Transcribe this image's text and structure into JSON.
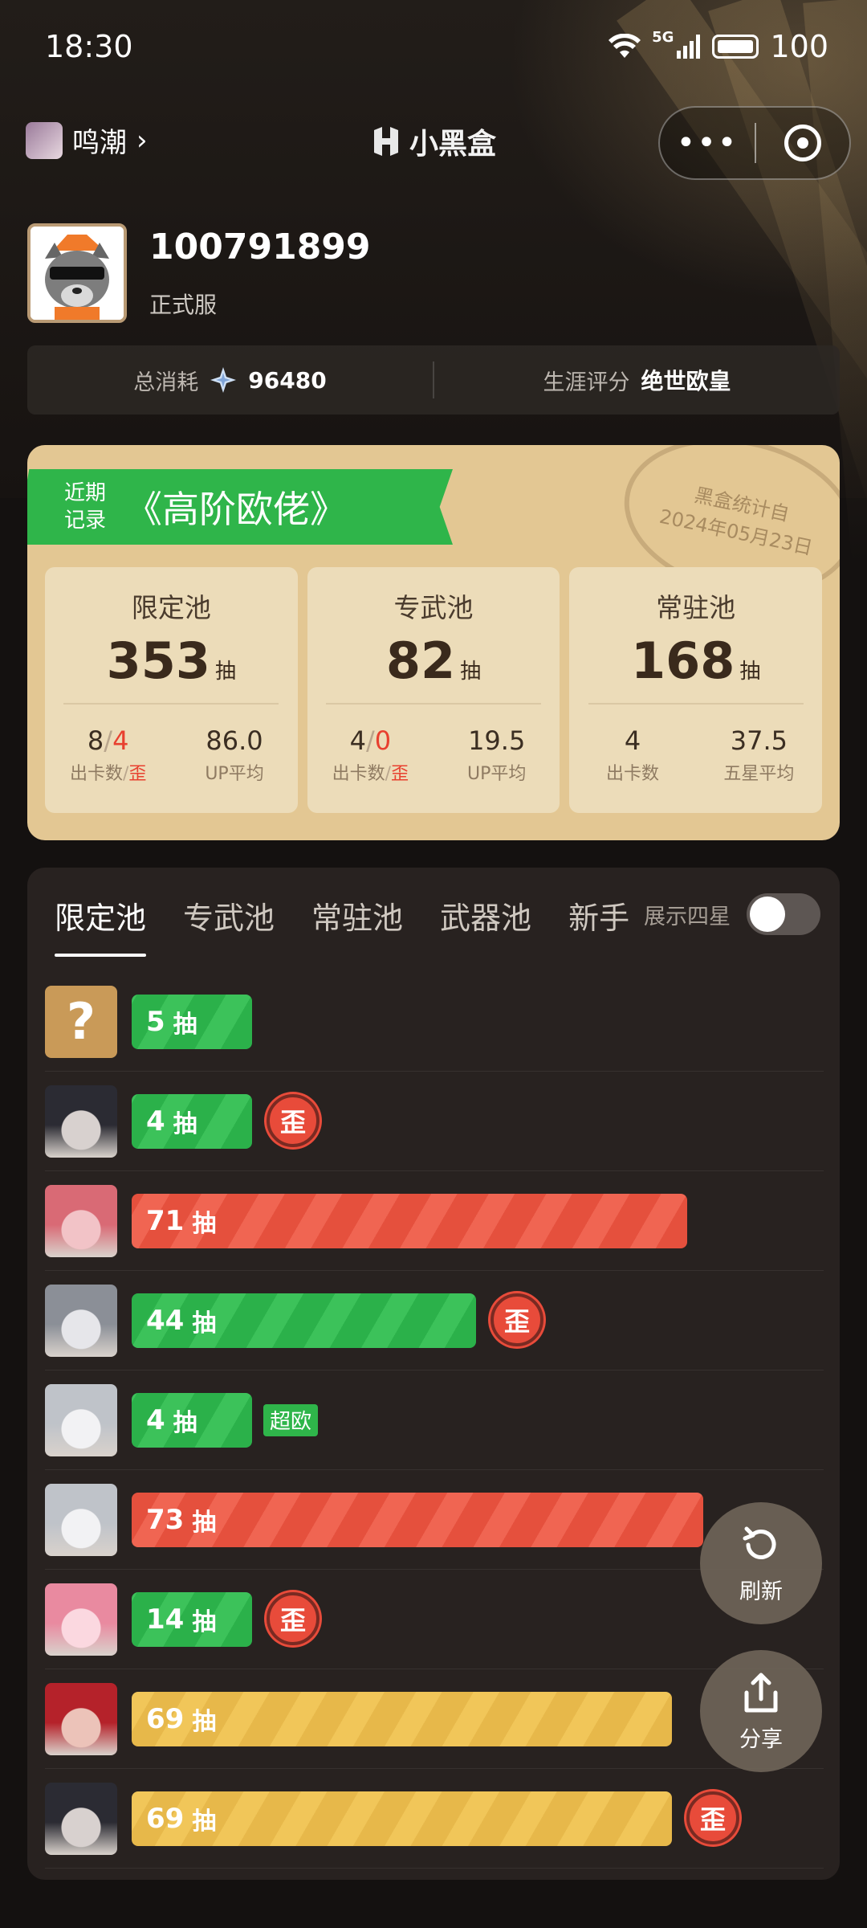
{
  "status_bar": {
    "time": "18:30",
    "network": "5G",
    "battery": "100"
  },
  "header": {
    "game_name": "鸣潮",
    "brand": "小黑盒",
    "capsule_more": "•••"
  },
  "profile": {
    "uid": "100791899",
    "server": "正式服"
  },
  "summary": {
    "total_label": "总消耗",
    "total_value": "96480",
    "career_label": "生涯评分",
    "career_value": "绝世欧皇"
  },
  "record_card": {
    "ribbon_small_1": "近期",
    "ribbon_small_2": "记录",
    "ribbon_title": "《高阶欧佬》",
    "stamp_line1": "黑盒统计自",
    "stamp_line2": "2024年05月23日",
    "pull_unit": "抽",
    "pools": [
      {
        "name": "限定池",
        "count": "353",
        "a": "8",
        "b": "4",
        "label_a": "出卡数",
        "label_b": "歪",
        "avg": "86.0",
        "avg_label": "UP平均"
      },
      {
        "name": "专武池",
        "count": "82",
        "a": "4",
        "b": "0",
        "label_a": "出卡数",
        "label_b": "歪",
        "avg": "19.5",
        "avg_label": "UP平均"
      },
      {
        "name": "常驻池",
        "count": "168",
        "a": "4",
        "label_a": "出卡数",
        "avg": "37.5",
        "avg_label": "五星平均"
      }
    ]
  },
  "history": {
    "tabs": [
      "限定池",
      "专武池",
      "常驻池",
      "武器池",
      "新手"
    ],
    "toggle_label": "展示四星",
    "toggle_on": false,
    "pull_unit": "抽",
    "badge_wai": "歪",
    "badge_chao": "超欧",
    "max_pulls": 80,
    "rows": [
      {
        "pulls": "5",
        "color": "green",
        "tag": "",
        "avatar": "unknown"
      },
      {
        "pulls": "4",
        "color": "green",
        "tag": "wai",
        "avatar": "dark-hair"
      },
      {
        "pulls": "71",
        "color": "red",
        "tag": "",
        "avatar": "pink-hair"
      },
      {
        "pulls": "44",
        "color": "green",
        "tag": "wai",
        "avatar": "silver-hair"
      },
      {
        "pulls": "4",
        "color": "green",
        "tag": "chao",
        "avatar": "white-hair"
      },
      {
        "pulls": "73",
        "color": "red",
        "tag": "",
        "avatar": "white-hair"
      },
      {
        "pulls": "14",
        "color": "green",
        "tag": "wai",
        "avatar": "pink-cat"
      },
      {
        "pulls": "69",
        "color": "yellow",
        "tag": "",
        "avatar": "red-hair"
      },
      {
        "pulls": "69",
        "color": "yellow",
        "tag": "wai",
        "avatar": "dark-hair"
      }
    ]
  },
  "fab": {
    "refresh": "刷新",
    "share": "分享"
  },
  "colors": {
    "green": "#2bb14a",
    "red": "#e5503d",
    "yellow": "#e7b84a",
    "gold_card": "#e3c793"
  }
}
